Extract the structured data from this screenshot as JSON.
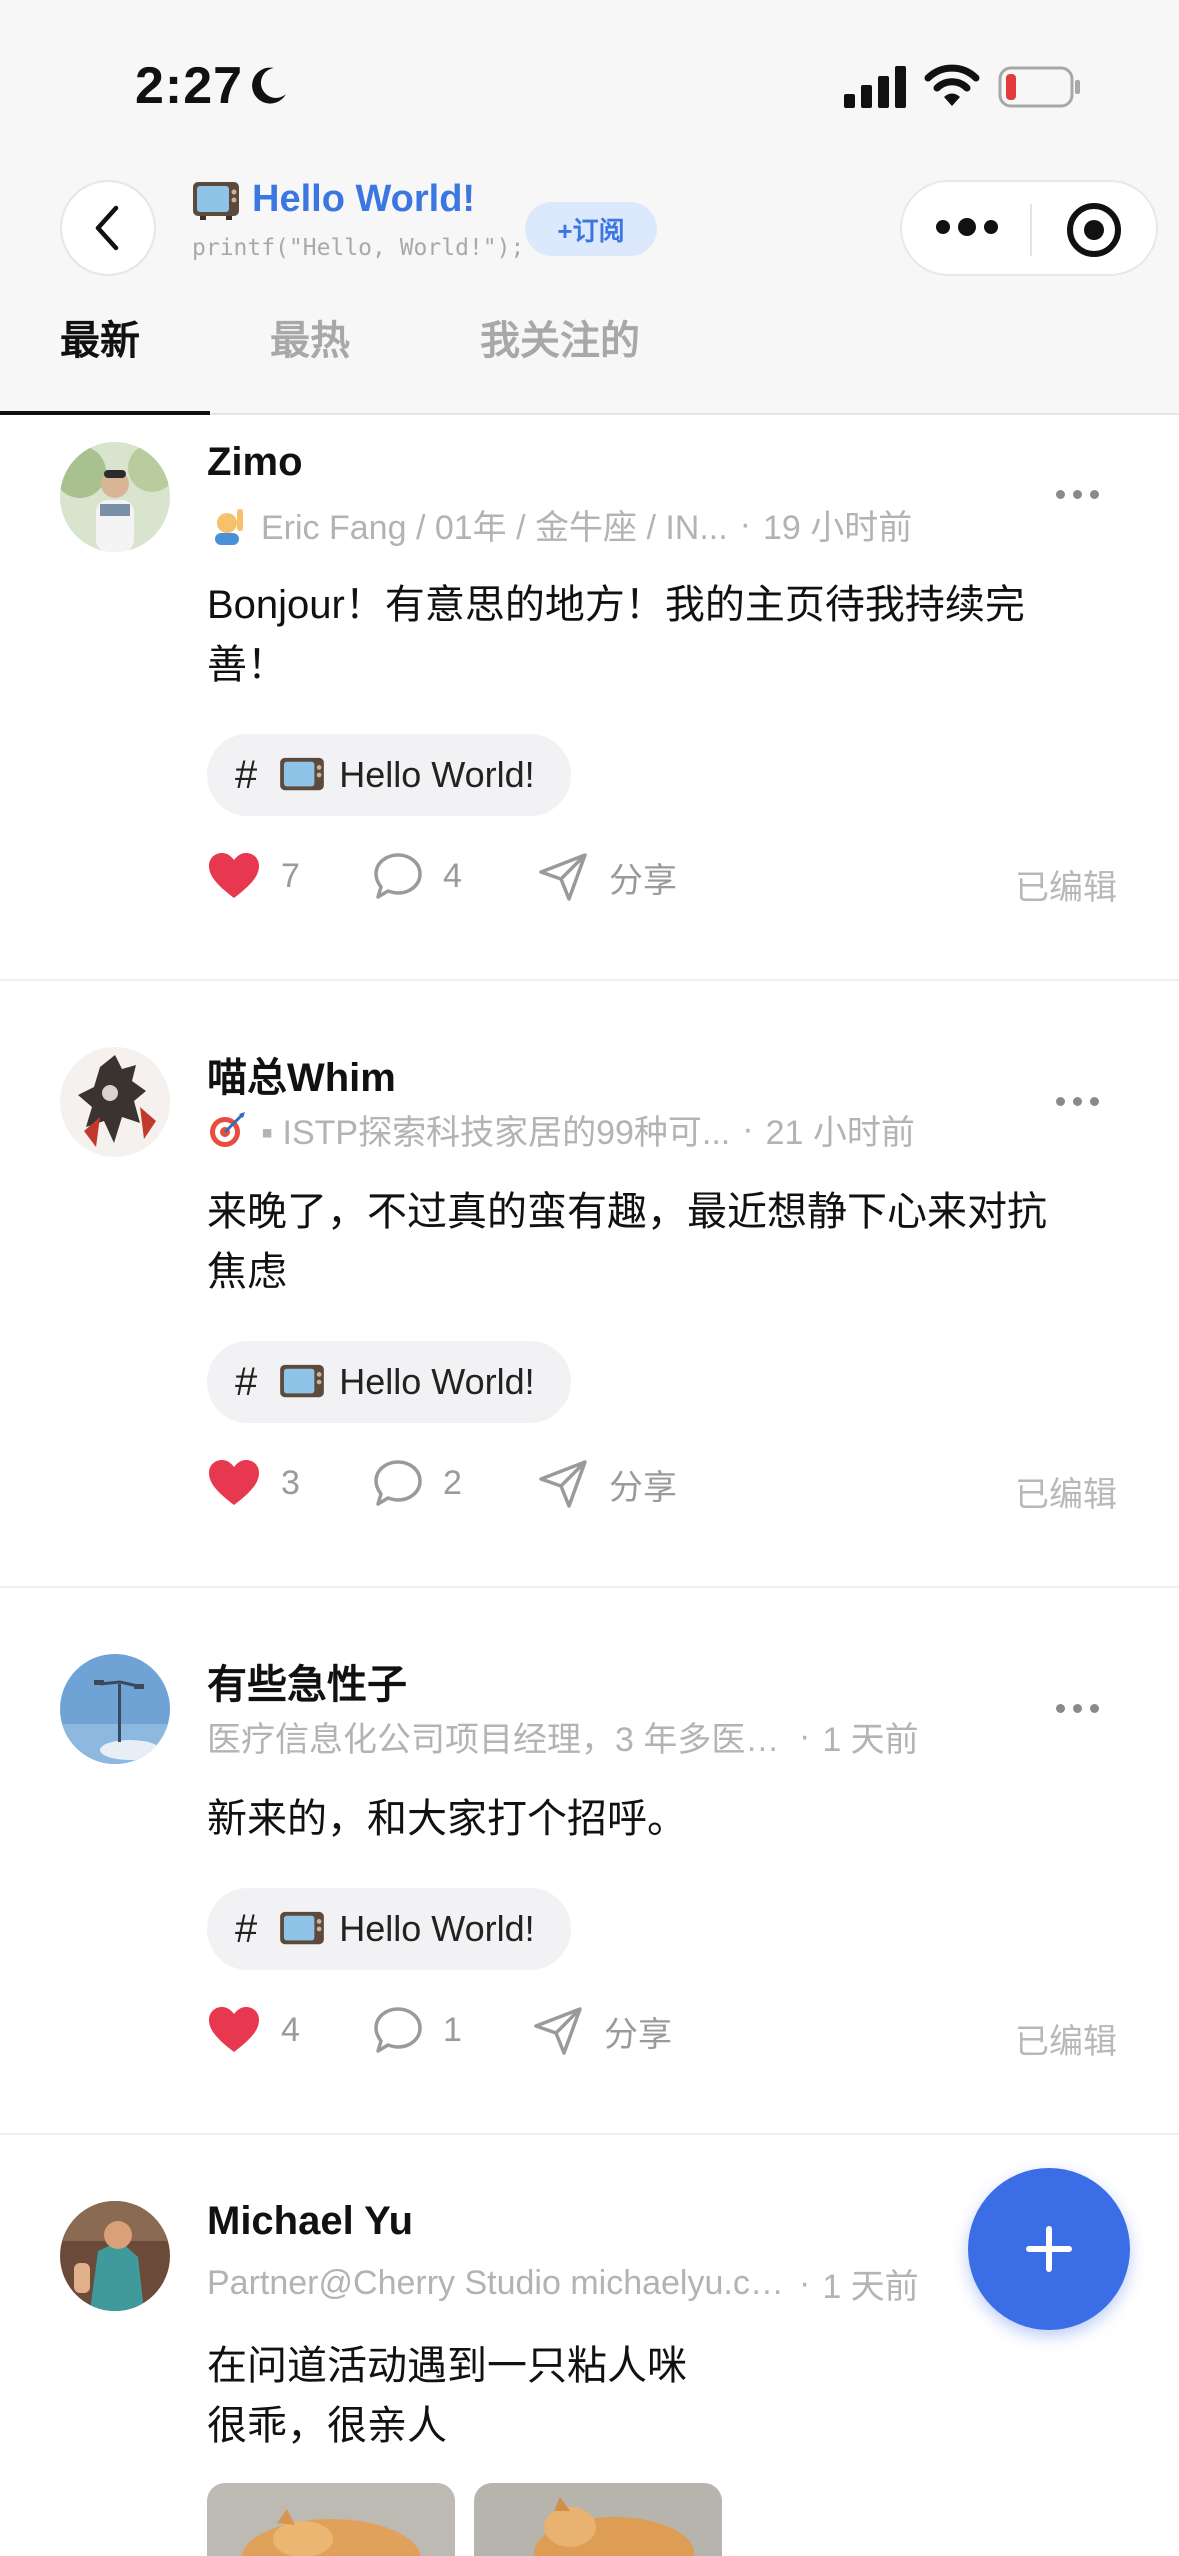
{
  "status_bar": {
    "time": "2:27"
  },
  "header": {
    "title": "Hello World!",
    "subtitle": "printf(\"Hello, World!\");",
    "subscribe_label": "+订阅"
  },
  "tabs": [
    {
      "label": "最新",
      "active": true
    },
    {
      "label": "最热",
      "active": false
    },
    {
      "label": "我关注的",
      "active": false
    }
  ],
  "posts": [
    {
      "author": "Zimo",
      "bio": "Eric Fang / 01年 / 金牛座 / IN...",
      "time": "19 小时前",
      "content_lines": [
        "Bonjour！有意思的地方！我的主页待我持续完",
        "善！"
      ],
      "topic": "Hello World!",
      "likes": "7",
      "comments": "4",
      "share": "分享",
      "edited": "已编辑"
    },
    {
      "author": "喵总Whim",
      "bio": "▪ ISTP探索科技家居的99种可...",
      "time": "21 小时前",
      "content_lines": [
        "来晚了，不过真的蛮有趣，最近想静下心来对抗",
        "焦虑"
      ],
      "topic": "Hello World!",
      "likes": "3",
      "comments": "2",
      "share": "分享",
      "edited": "已编辑"
    },
    {
      "author": "有些急性子",
      "bio": "医疗信息化公司项目经理，3 年多医疗...",
      "time": "1 天前",
      "content_lines": [
        "新来的，和大家打个招呼。"
      ],
      "topic": "Hello World!",
      "likes": "4",
      "comments": "1",
      "share": "分享",
      "edited": "已编辑"
    },
    {
      "author": "Michael Yu",
      "bio": "Partner@Cherry Studio michaelyu.cn...",
      "time": "1 天前",
      "content_lines": [
        "在问道活动遇到一只粘人咪",
        "很乖，很亲人"
      ]
    }
  ],
  "colors": {
    "accent": "#3b76e1",
    "like": "#e8384f",
    "fab": "#3b6ee6"
  }
}
